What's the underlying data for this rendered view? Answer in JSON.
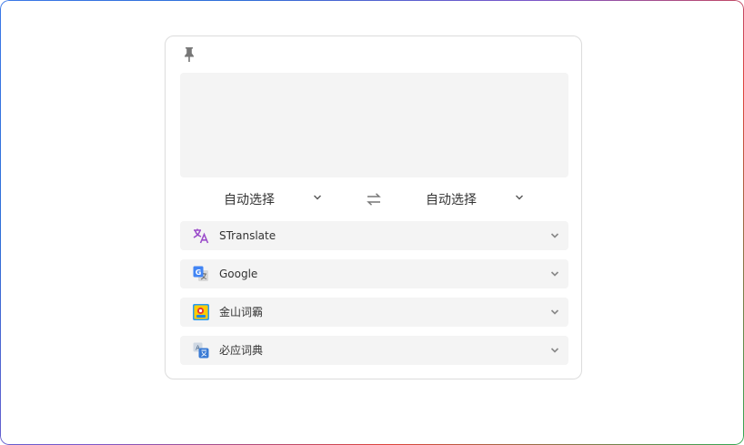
{
  "source": {
    "text": "",
    "placeholder": ""
  },
  "languages": {
    "source": {
      "selected": "自动选择"
    },
    "target": {
      "selected": "自动选择"
    }
  },
  "services": [
    {
      "name": "STranslate",
      "icon": "stranslate-icon"
    },
    {
      "name": "Google",
      "icon": "google-translate-icon"
    },
    {
      "name": "金山词霸",
      "icon": "iciba-icon"
    },
    {
      "name": "必应词典",
      "icon": "bing-dict-icon"
    }
  ],
  "colors": {
    "accent_purple": "#9b4dca",
    "panel_bg": "#f4f4f4",
    "card_border": "#dcdcdc"
  }
}
